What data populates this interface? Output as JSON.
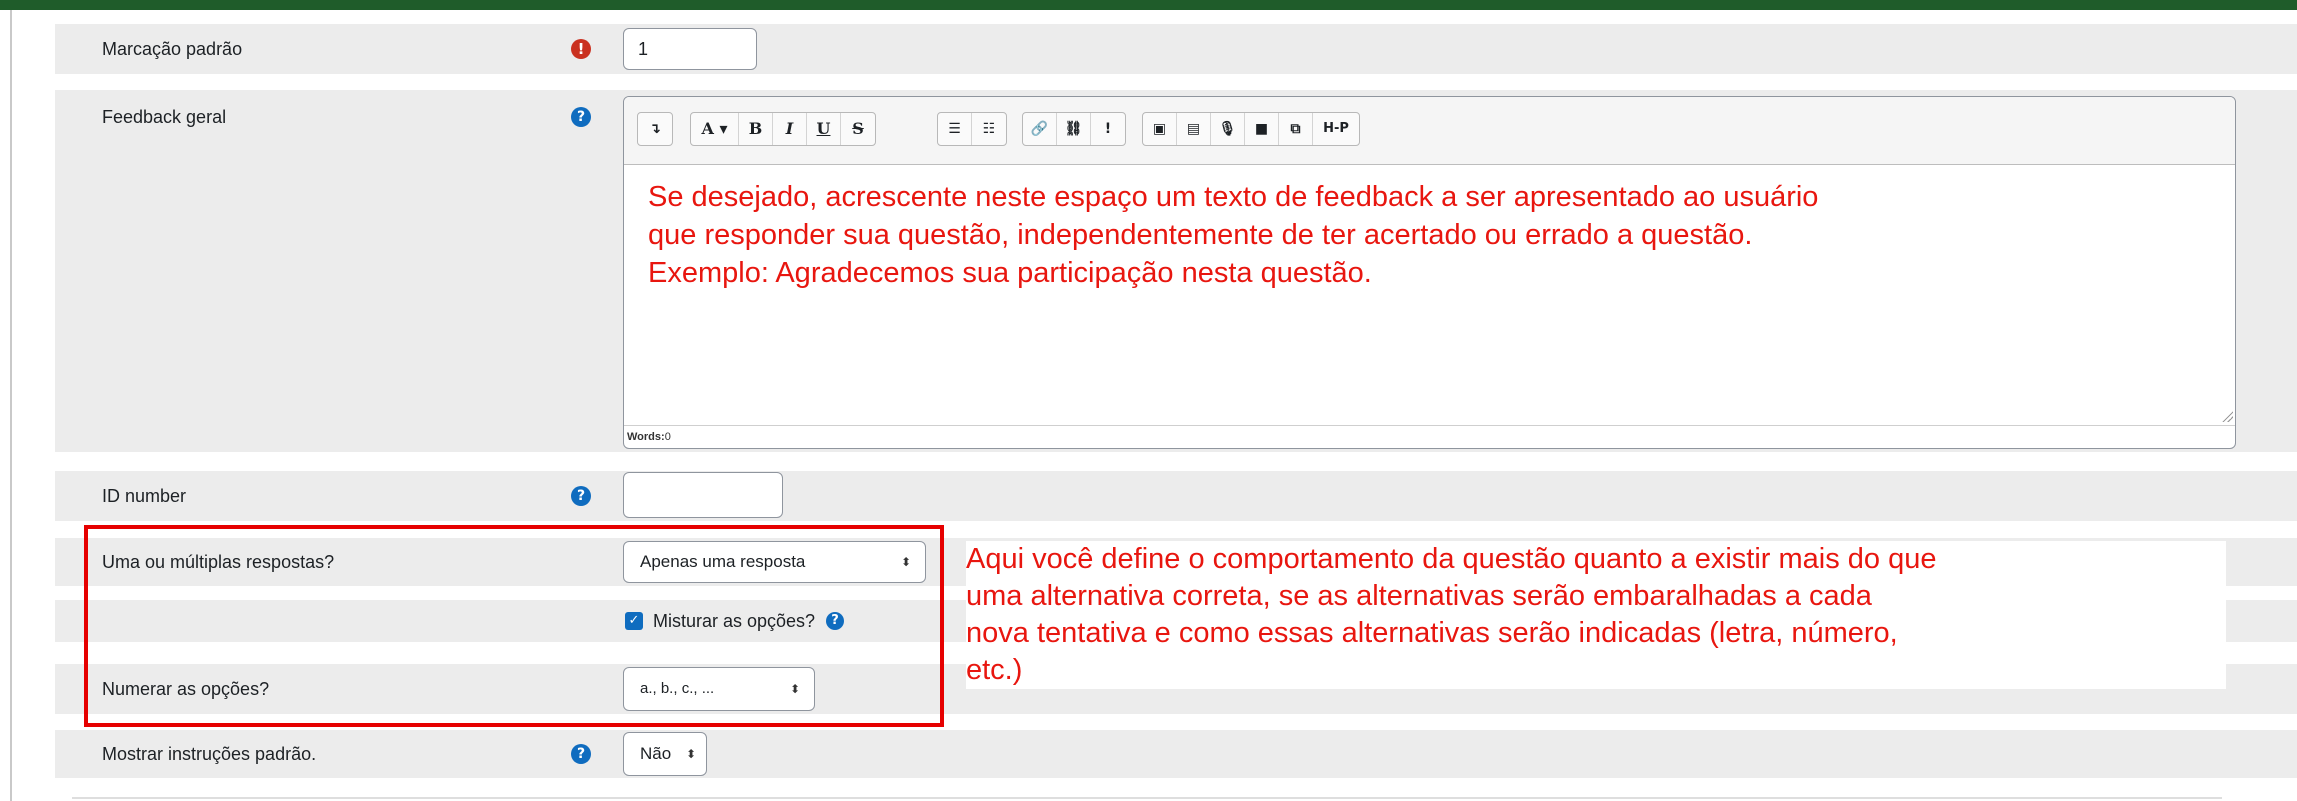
{
  "form": {
    "default_mark": {
      "label": "Marcação padrão",
      "value": "1",
      "icon": "required-icon"
    },
    "general_feedback": {
      "label": "Feedback geral",
      "icon": "help-icon",
      "toolbar": [
        [
          "↴"
        ],
        [
          "A ▾",
          "B",
          "I",
          "U",
          "S"
        ],
        [
          "☰",
          "☷"
        ],
        [
          "🔗",
          "⛓",
          "!"
        ],
        [
          "▣",
          "▤",
          "🎙",
          "■",
          "⧉",
          "H-P"
        ]
      ],
      "editor_lines": [
        "Se desejado, acrescente neste espaço um texto de feedback a ser apresentado ao usuário",
        "que responder sua questão, independentemente de ter acertado ou errado a questão.",
        "Exemplo: Agradecemos sua participação nesta questão."
      ],
      "words_label": "Words:",
      "words_count": "0"
    },
    "id_number": {
      "label": "ID number",
      "value": "",
      "icon": "help-icon"
    },
    "single_multiple": {
      "label": "Uma ou múltiplas respostas?",
      "value": "Apenas uma resposta"
    },
    "shuffle": {
      "label": "Misturar as opções?",
      "checked": true,
      "icon": "help-icon"
    },
    "numbering": {
      "label": "Numerar as opções?",
      "value": "a., b., c., ..."
    },
    "show_instructions": {
      "label": "Mostrar instruções padrão.",
      "value": "Não",
      "icon": "help-icon"
    }
  },
  "annotation": {
    "color": "#e60000",
    "lines": [
      "Aqui você define o comportamento da questão quanto a existir mais do que",
      "uma alternativa correta, se as alternativas serão embaralhadas a cada",
      "nova tentativa e como essas alternativas serão indicadas (letra, número,",
      "etc.)"
    ]
  },
  "colors": {
    "header": "#1f5c2a",
    "required": "#ca3120",
    "help": "#0f6cbf",
    "row_bg": "#ececec"
  }
}
